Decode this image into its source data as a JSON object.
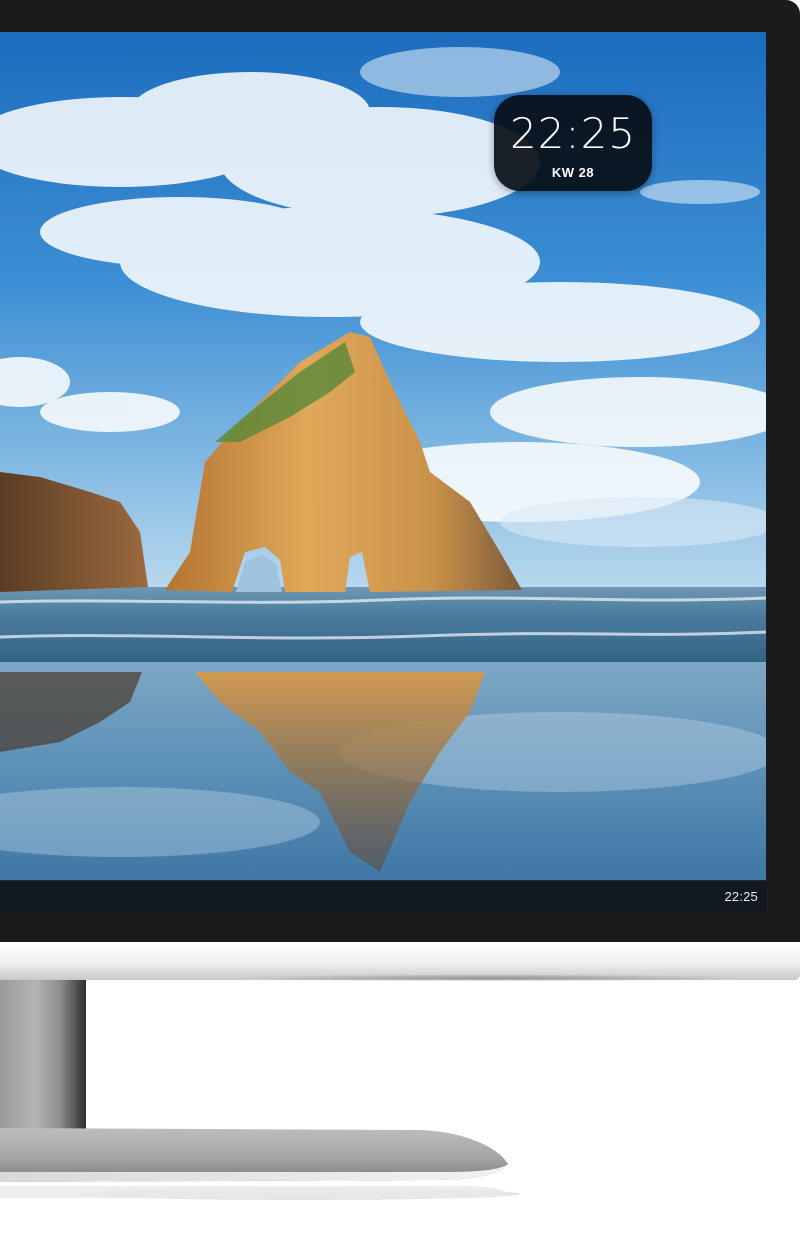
{
  "desktop": {
    "clock_widget": {
      "time": "22:25",
      "week_label": "KW 28"
    },
    "taskbar": {
      "time": "22:25"
    }
  },
  "colors": {
    "bezel": "#1b1b1d",
    "taskbar": "#11181f",
    "widget_bg": "#080e16",
    "sky_top": "#1d6fc0",
    "sky_bottom": "#8fc3e6",
    "rock": "#c98a3e",
    "sea": "#3d6f8f",
    "stand": "#a8a8a8"
  },
  "icons": {
    "wallpaper": "rock-arch-beach-landscape"
  }
}
